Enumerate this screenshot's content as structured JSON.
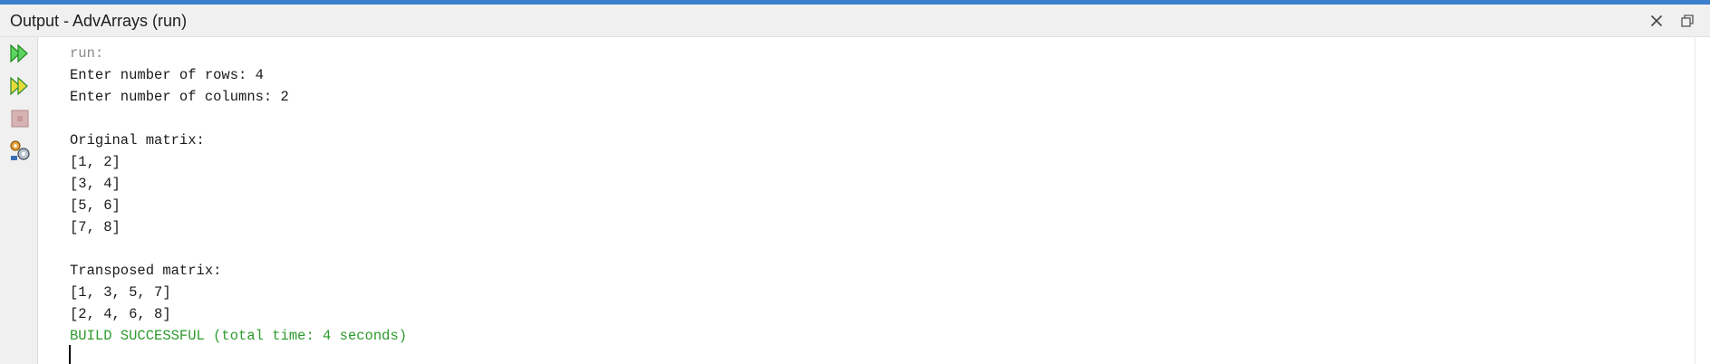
{
  "window": {
    "title": "Output - AdvArrays (run)",
    "accent_color": "#3d7fcc"
  },
  "toolbar": {
    "rerun_icon": "double-play-icon",
    "rerun_with_params_icon": "double-play-yellow-icon",
    "stop_icon": "stop-icon",
    "settings_icon": "settings-icon"
  },
  "console": {
    "lines": [
      "run:",
      "Enter number of rows: 4",
      "Enter number of columns: 2",
      "",
      "Original matrix:",
      "[1, 2]",
      "[3, 4]",
      "[5, 6]",
      "[7, 8]",
      "",
      "Transposed matrix:",
      "[1, 3, 5, 7]",
      "[2, 4, 6, 8]",
      "BUILD SUCCESSFUL (total time: 4 seconds)"
    ],
    "success_color": "#2d9b2d"
  }
}
